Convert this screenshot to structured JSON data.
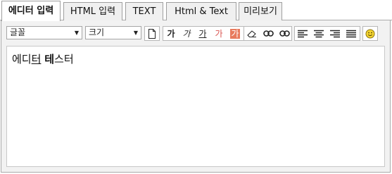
{
  "tabs": [
    {
      "label": "에디터 입력",
      "active": true
    },
    {
      "label": "HTML 입력",
      "active": false
    },
    {
      "label": "TEXT",
      "active": false
    },
    {
      "label": "Html & Text",
      "active": false
    },
    {
      "label": "미리보기",
      "active": false
    }
  ],
  "toolbar": {
    "font_select": {
      "value": "글꼴"
    },
    "size_select": {
      "value": "크기"
    },
    "glyphs": {
      "bold": "가",
      "italic": "가",
      "underline": "가",
      "font_color": "가",
      "background_color": "가"
    },
    "icons": [
      "new-document-icon",
      "bold-icon",
      "italic-icon",
      "underline-icon",
      "font-color-icon",
      "background-color-icon",
      "eraser-icon",
      "link-icon",
      "unlink-icon",
      "align-left-icon",
      "align-center-icon",
      "align-right-icon",
      "align-justify-icon",
      "emoticon-icon"
    ]
  },
  "editor": {
    "segments": [
      {
        "text": "에디",
        "style": "normal"
      },
      {
        "text": "터",
        "style": "underline"
      },
      {
        "text": " ",
        "style": "normal"
      },
      {
        "text": "테",
        "style": "bold"
      },
      {
        "text": "스터",
        "style": "normal"
      }
    ]
  },
  "colors": {
    "font_color_glyph": "#d9534f",
    "background_color_fill": "#e87a5d",
    "emoticon": "#f5d531",
    "tab_line": "#aaaaaa",
    "panel_bg": "#f2f2f2"
  }
}
